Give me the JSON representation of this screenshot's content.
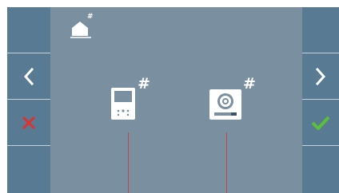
{
  "colors": {
    "screen_bg": "#7a8f9f",
    "sidebar_bg": "#587a92",
    "cancel_red": "#e03030",
    "confirm_green": "#5cc03a",
    "wire_red": "#b94a4a"
  },
  "header": {
    "home_icon": "house-icon",
    "home_badge": "#"
  },
  "left_sidebar": {
    "buttons": [
      {
        "name": "empty",
        "icon": ""
      },
      {
        "name": "previous",
        "icon": "chevron-left-icon"
      },
      {
        "name": "cancel",
        "icon": "cross-icon"
      },
      {
        "name": "empty",
        "icon": ""
      }
    ]
  },
  "right_sidebar": {
    "buttons": [
      {
        "name": "empty",
        "icon": ""
      },
      {
        "name": "next",
        "icon": "chevron-right-icon"
      },
      {
        "name": "confirm",
        "icon": "check-icon"
      },
      {
        "name": "empty",
        "icon": ""
      }
    ]
  },
  "devices": [
    {
      "name": "indoor-monitor",
      "icon": "monitor-icon",
      "badge": "#"
    },
    {
      "name": "door-panel",
      "icon": "door-panel-icon",
      "badge": "#"
    }
  ]
}
